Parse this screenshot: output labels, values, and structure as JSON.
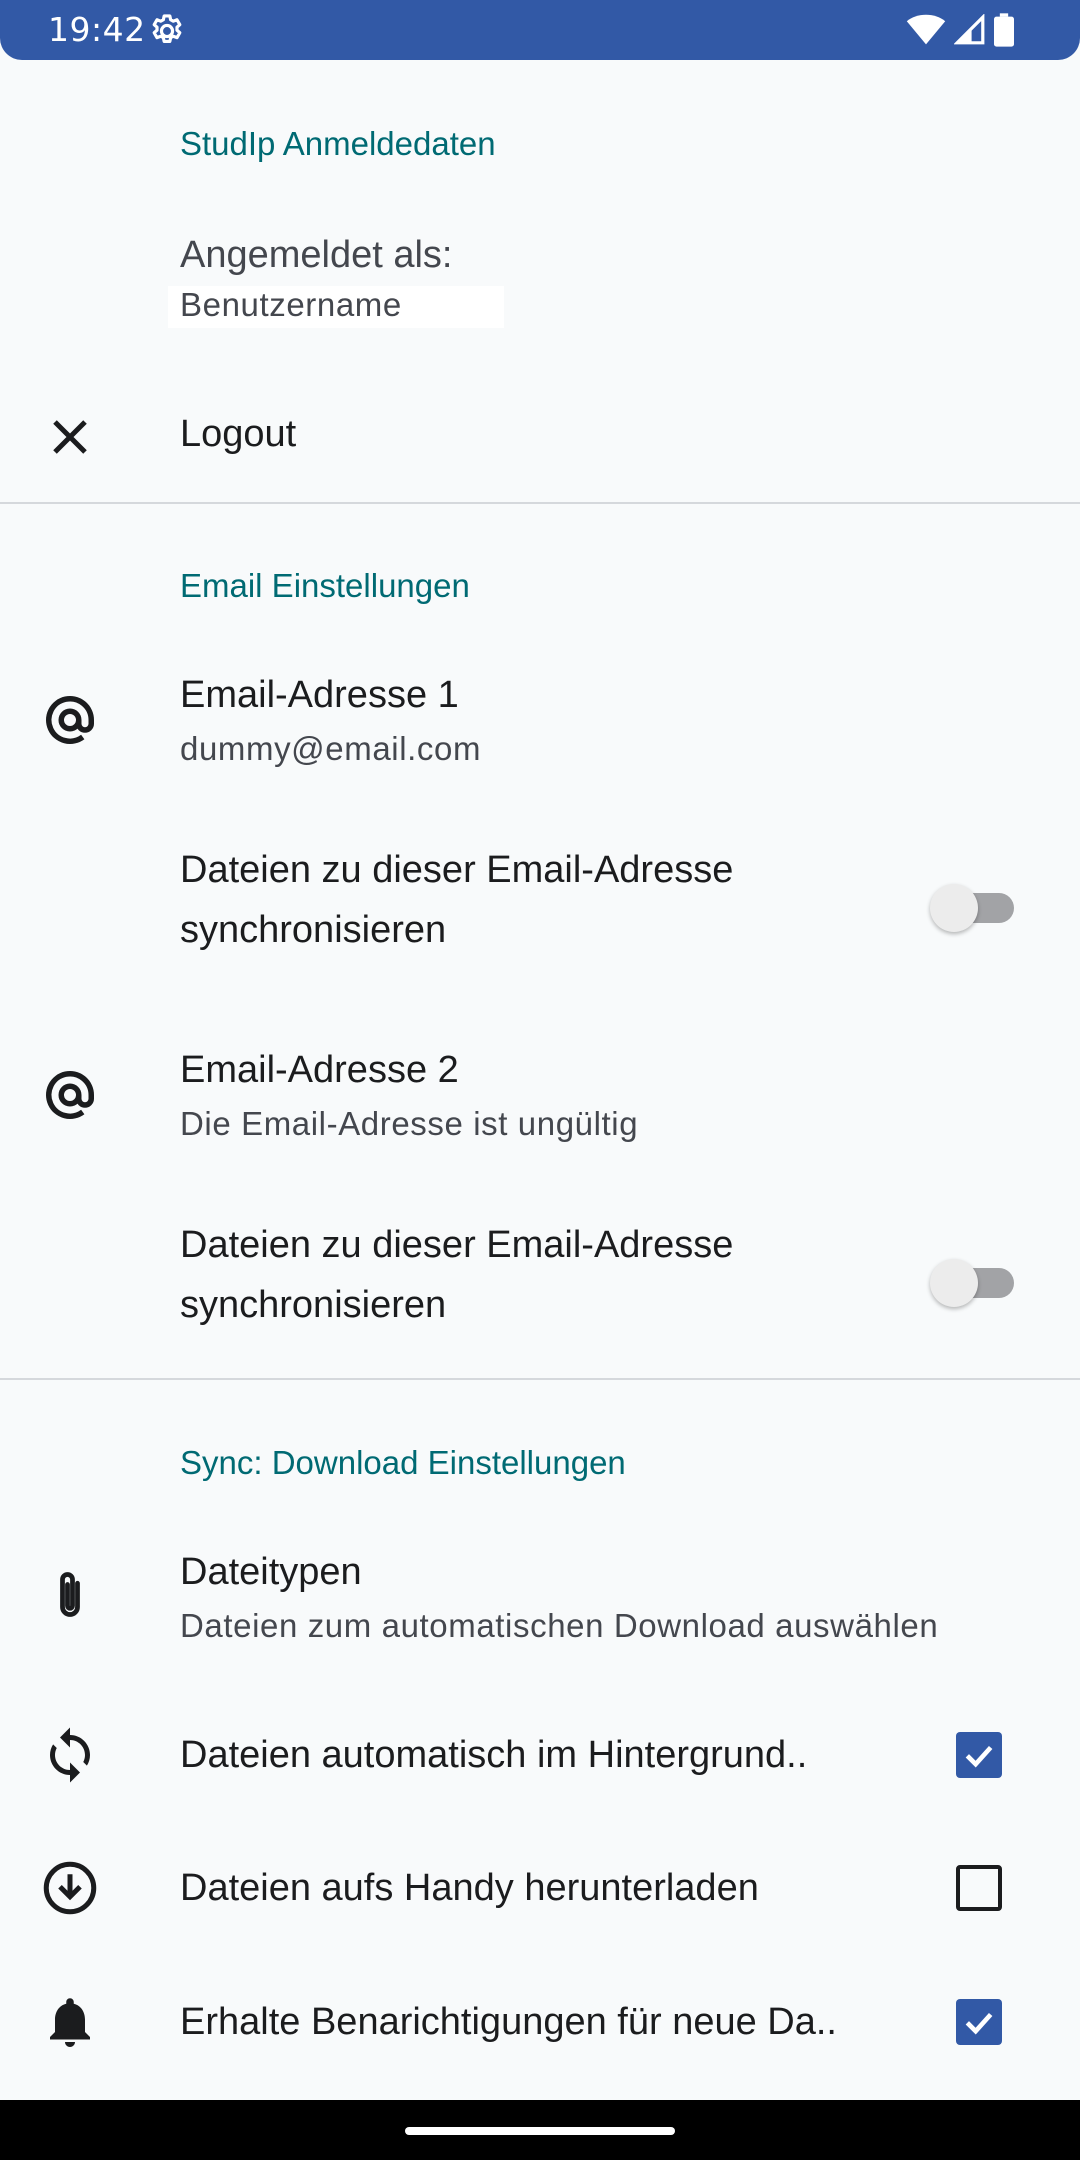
{
  "status_bar": {
    "time": "19:42",
    "icons": [
      "settings-gear-icon",
      "wifi-icon",
      "cell-signal-icon",
      "battery-icon"
    ]
  },
  "studip_section": {
    "header": "StudIp Anmeldedaten",
    "logged_in_label": "Angemeldet als:",
    "username": "Benutzername",
    "logout": {
      "label": "Logout",
      "icon": "close-icon"
    }
  },
  "email_section": {
    "header": "Email Einstellungen",
    "emails": [
      {
        "title": "Email-Adresse 1",
        "value": "dummy@email.com",
        "icon": "at-sign-icon",
        "sync_label": "Dateien zu dieser Email-Adresse synchronisieren",
        "sync_enabled": false
      },
      {
        "title": "Email-Adresse 2",
        "value": "Die Email-Adresse ist ungültig",
        "icon": "at-sign-icon",
        "sync_label": "Dateien zu dieser Email-Adresse synchronisieren",
        "sync_enabled": false
      }
    ]
  },
  "sync_section": {
    "header": "Sync: Download Einstellungen",
    "filetypes": {
      "title": "Dateitypen",
      "summary": "Dateien zum automatischen Download auswählen",
      "icon": "paperclip-icon"
    },
    "options": [
      {
        "label": "Dateien automatisch im Hintergrund..",
        "checked": true,
        "icon": "sync-icon"
      },
      {
        "label": "Dateien aufs Handy herunterladen",
        "checked": false,
        "icon": "download-circle-icon"
      },
      {
        "label": "Erhalte Benarichtigungen für neue Da..",
        "checked": true,
        "icon": "bell-icon"
      }
    ]
  },
  "colors": {
    "status_bar": "#3259a6",
    "accent_header": "#006a73",
    "checkbox": "#3259a6",
    "background": "#f8fafb"
  }
}
